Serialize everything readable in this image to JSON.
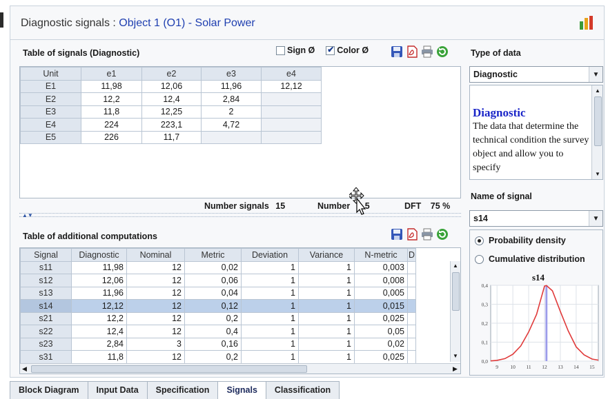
{
  "window": {
    "title_prefix": "Diagnostic signals :",
    "title_object": "Object 1 (O1) - Solar Power",
    "app_icon": "bar-chart-icon"
  },
  "signals_table": {
    "title": "Table of signals (Diagnostic)",
    "sign_label": "Sign Ø",
    "sign_checked": false,
    "color_label": "Color Ø",
    "color_checked": true,
    "columns": [
      "Unit",
      "e1",
      "e2",
      "e3",
      "e4"
    ],
    "rows": [
      {
        "unit": "E1",
        "values": [
          "11,98",
          "12,06",
          "11,96",
          "12,12"
        ]
      },
      {
        "unit": "E2",
        "values": [
          "12,2",
          "12,4",
          "2,84",
          ""
        ]
      },
      {
        "unit": "E3",
        "values": [
          "11,8",
          "12,25",
          "2",
          ""
        ]
      },
      {
        "unit": "E4",
        "values": [
          "224",
          "223,1",
          "4,72",
          ""
        ]
      },
      {
        "unit": "E5",
        "values": [
          "226",
          "11,7",
          "",
          ""
        ]
      }
    ],
    "number_signals_label": "Number signals",
    "number_signals_value": "15",
    "number_label": "Number",
    "number_value": "5",
    "dft_label": "DFT",
    "dft_value": "75 %"
  },
  "computations_table": {
    "title": "Table of additional computations",
    "columns": [
      "Signal",
      "Diagnostic",
      "Nominal",
      "Metric",
      "Deviation",
      "Variance",
      "N-metric",
      "D"
    ],
    "rows": [
      {
        "signal": "s11",
        "diagnostic": "11,98",
        "nominal": "12",
        "metric": "0,02",
        "deviation": "1",
        "variance": "1",
        "nmetric": "0,003"
      },
      {
        "signal": "s12",
        "diagnostic": "12,06",
        "nominal": "12",
        "metric": "0,06",
        "deviation": "1",
        "variance": "1",
        "nmetric": "0,008"
      },
      {
        "signal": "s13",
        "diagnostic": "11,96",
        "nominal": "12",
        "metric": "0,04",
        "deviation": "1",
        "variance": "1",
        "nmetric": "0,005"
      },
      {
        "signal": "s14",
        "diagnostic": "12,12",
        "nominal": "12",
        "metric": "0,12",
        "deviation": "1",
        "variance": "1",
        "nmetric": "0,015"
      },
      {
        "signal": "s21",
        "diagnostic": "12,2",
        "nominal": "12",
        "metric": "0,2",
        "deviation": "1",
        "variance": "1",
        "nmetric": "0,025"
      },
      {
        "signal": "s22",
        "diagnostic": "12,4",
        "nominal": "12",
        "metric": "0,4",
        "deviation": "1",
        "variance": "1",
        "nmetric": "0,05"
      },
      {
        "signal": "s23",
        "diagnostic": "2,84",
        "nominal": "3",
        "metric": "0,16",
        "deviation": "1",
        "variance": "1",
        "nmetric": "0,02"
      },
      {
        "signal": "s31",
        "diagnostic": "11,8",
        "nominal": "12",
        "metric": "0,2",
        "deviation": "1",
        "variance": "1",
        "nmetric": "0,025"
      }
    ],
    "selected_row": 3
  },
  "right_panel": {
    "type_of_data_label": "Type of data",
    "type_of_data_value": "Diagnostic",
    "description_title": "Diagnostic",
    "description_text": "The data that determine the technical condition the survey object and allow you to specify",
    "name_of_signal_label": "Name of signal",
    "name_of_signal_value": "s14",
    "radio_options": [
      {
        "label": "Probability density",
        "selected": true
      },
      {
        "label": "Cumulative distribution",
        "selected": false
      }
    ]
  },
  "chart_data": {
    "type": "line",
    "title": "s14",
    "xlabel": "",
    "ylabel": "",
    "xlim": [
      8.6,
      15.4
    ],
    "ylim": [
      0,
      0.4
    ],
    "x_ticks": [
      "9",
      "10",
      "11",
      "12",
      "13",
      "14",
      "15"
    ],
    "y_ticks": [
      "0,0",
      "0,1",
      "0,2",
      "0,3",
      "0,4"
    ],
    "grid": true,
    "series": [
      {
        "color": "#e03a3a",
        "x": [
          8.6,
          9.0,
          9.5,
          10.0,
          10.5,
          11.0,
          11.5,
          12.0,
          12.12,
          12.5,
          13.0,
          13.5,
          14.0,
          14.5,
          15.0,
          15.4
        ],
        "y": [
          0.001,
          0.004,
          0.013,
          0.036,
          0.08,
          0.154,
          0.247,
          0.396,
          0.399,
          0.371,
          0.262,
          0.159,
          0.075,
          0.033,
          0.011,
          0.005
        ]
      }
    ],
    "marker_line": {
      "x": 12.12,
      "color": "#6d6ddf"
    }
  },
  "tabs": [
    {
      "label": "Block Diagram",
      "active": false
    },
    {
      "label": "Input Data",
      "active": false
    },
    {
      "label": "Specification",
      "active": false
    },
    {
      "label": "Signals",
      "active": true
    },
    {
      "label": "Classification",
      "active": false
    }
  ]
}
